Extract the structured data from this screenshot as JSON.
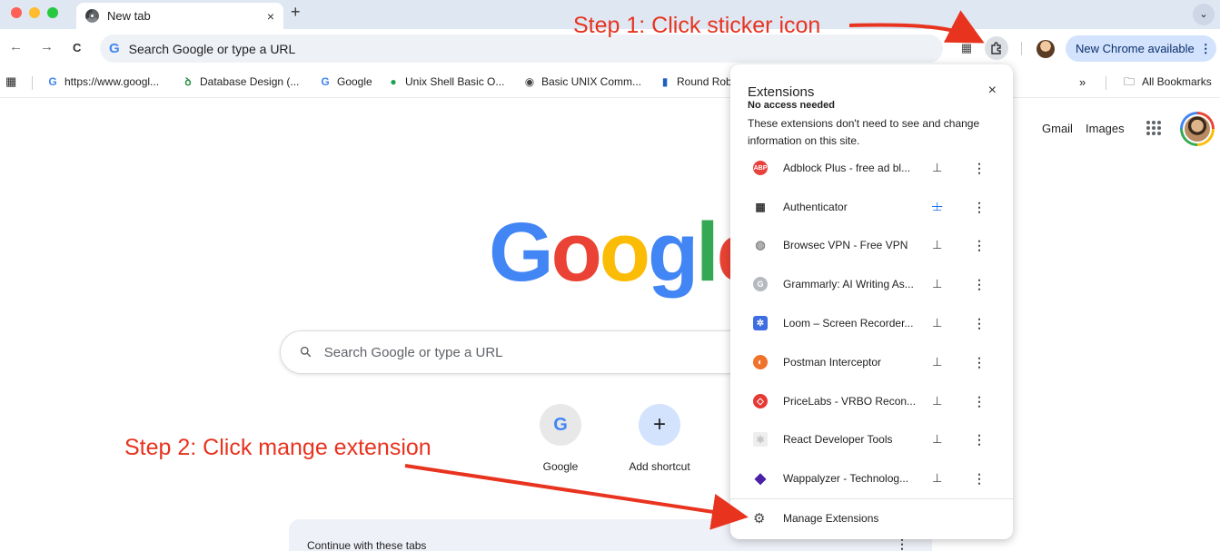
{
  "window": {
    "tab_title": "New tab",
    "tab_close": "×",
    "new_tab": "+",
    "tab_menu": "⌄"
  },
  "toolbar": {
    "back": "←",
    "forward": "→",
    "reload": "C",
    "omnibox_logo": "G",
    "omnibox_text": "Search Google or type a URL",
    "update_label": "New Chrome available",
    "update_more": "⋮"
  },
  "bookmarks": [
    {
      "icon": "G",
      "label": "https://www.googl..."
    },
    {
      "icon": "ꝺ",
      "label": "Database Design (..."
    },
    {
      "icon": "G",
      "label": "Google"
    },
    {
      "icon": "●",
      "label": "Unix Shell Basic O..."
    },
    {
      "icon": "◉",
      "label": "Basic UNIX Comm..."
    },
    {
      "icon": "▮",
      "label": "Round Rob"
    }
  ],
  "bookmarks_overflow": "»",
  "all_bookmarks": "All Bookmarks",
  "page": {
    "gmail": "Gmail",
    "images": "Images",
    "logo_letters": [
      "G",
      "o",
      "o",
      "g",
      "l",
      "e"
    ],
    "search_placeholder": "Search Google or type a URL",
    "shortcuts": [
      {
        "icon": "G",
        "label": "Google"
      },
      {
        "icon": "+",
        "label": "Add shortcut"
      }
    ],
    "continue_label": "Continue with these tabs",
    "continue_more": "⋮"
  },
  "extensions_popup": {
    "title": "Extensions",
    "close": "×",
    "subheading": "No access needed",
    "description": "These extensions don't need to see and change information on this site.",
    "items": [
      {
        "name": "Adblock Plus - free ad bl...",
        "icon": "ABP",
        "color": "#e8423f",
        "pinned": false
      },
      {
        "name": "Authenticator",
        "icon": "▦",
        "color": "#ffffff",
        "pinned": true
      },
      {
        "name": "Browsec VPN - Free VPN",
        "icon": "◍",
        "color": "#ffffff",
        "pinned": false
      },
      {
        "name": "Grammarly: AI Writing As...",
        "icon": "G",
        "color": "#b6b9be",
        "pinned": false
      },
      {
        "name": "Loom – Screen Recorder...",
        "icon": "✲",
        "color": "#3d6de0",
        "pinned": false
      },
      {
        "name": "Postman Interceptor",
        "icon": "◐",
        "color": "#f0722b",
        "pinned": false
      },
      {
        "name": "PriceLabs - VRBO Recon...",
        "icon": "◇",
        "color": "#e53935",
        "pinned": false
      },
      {
        "name": "React Developer Tools",
        "icon": "⚛",
        "color": "#eeeeee",
        "pinned": false
      },
      {
        "name": "Wappalyzer - Technolog...",
        "icon": "◆",
        "color": "#4b1fa8",
        "pinned": false
      }
    ],
    "pin_icon": "⊥",
    "menu_icon": "⋮",
    "manage_label": "Manage Extensions"
  },
  "annotations": {
    "step1": "Step 1: Click sticker icon",
    "step2": "Step 2: Click mange extension",
    "color": "#e8331f"
  }
}
